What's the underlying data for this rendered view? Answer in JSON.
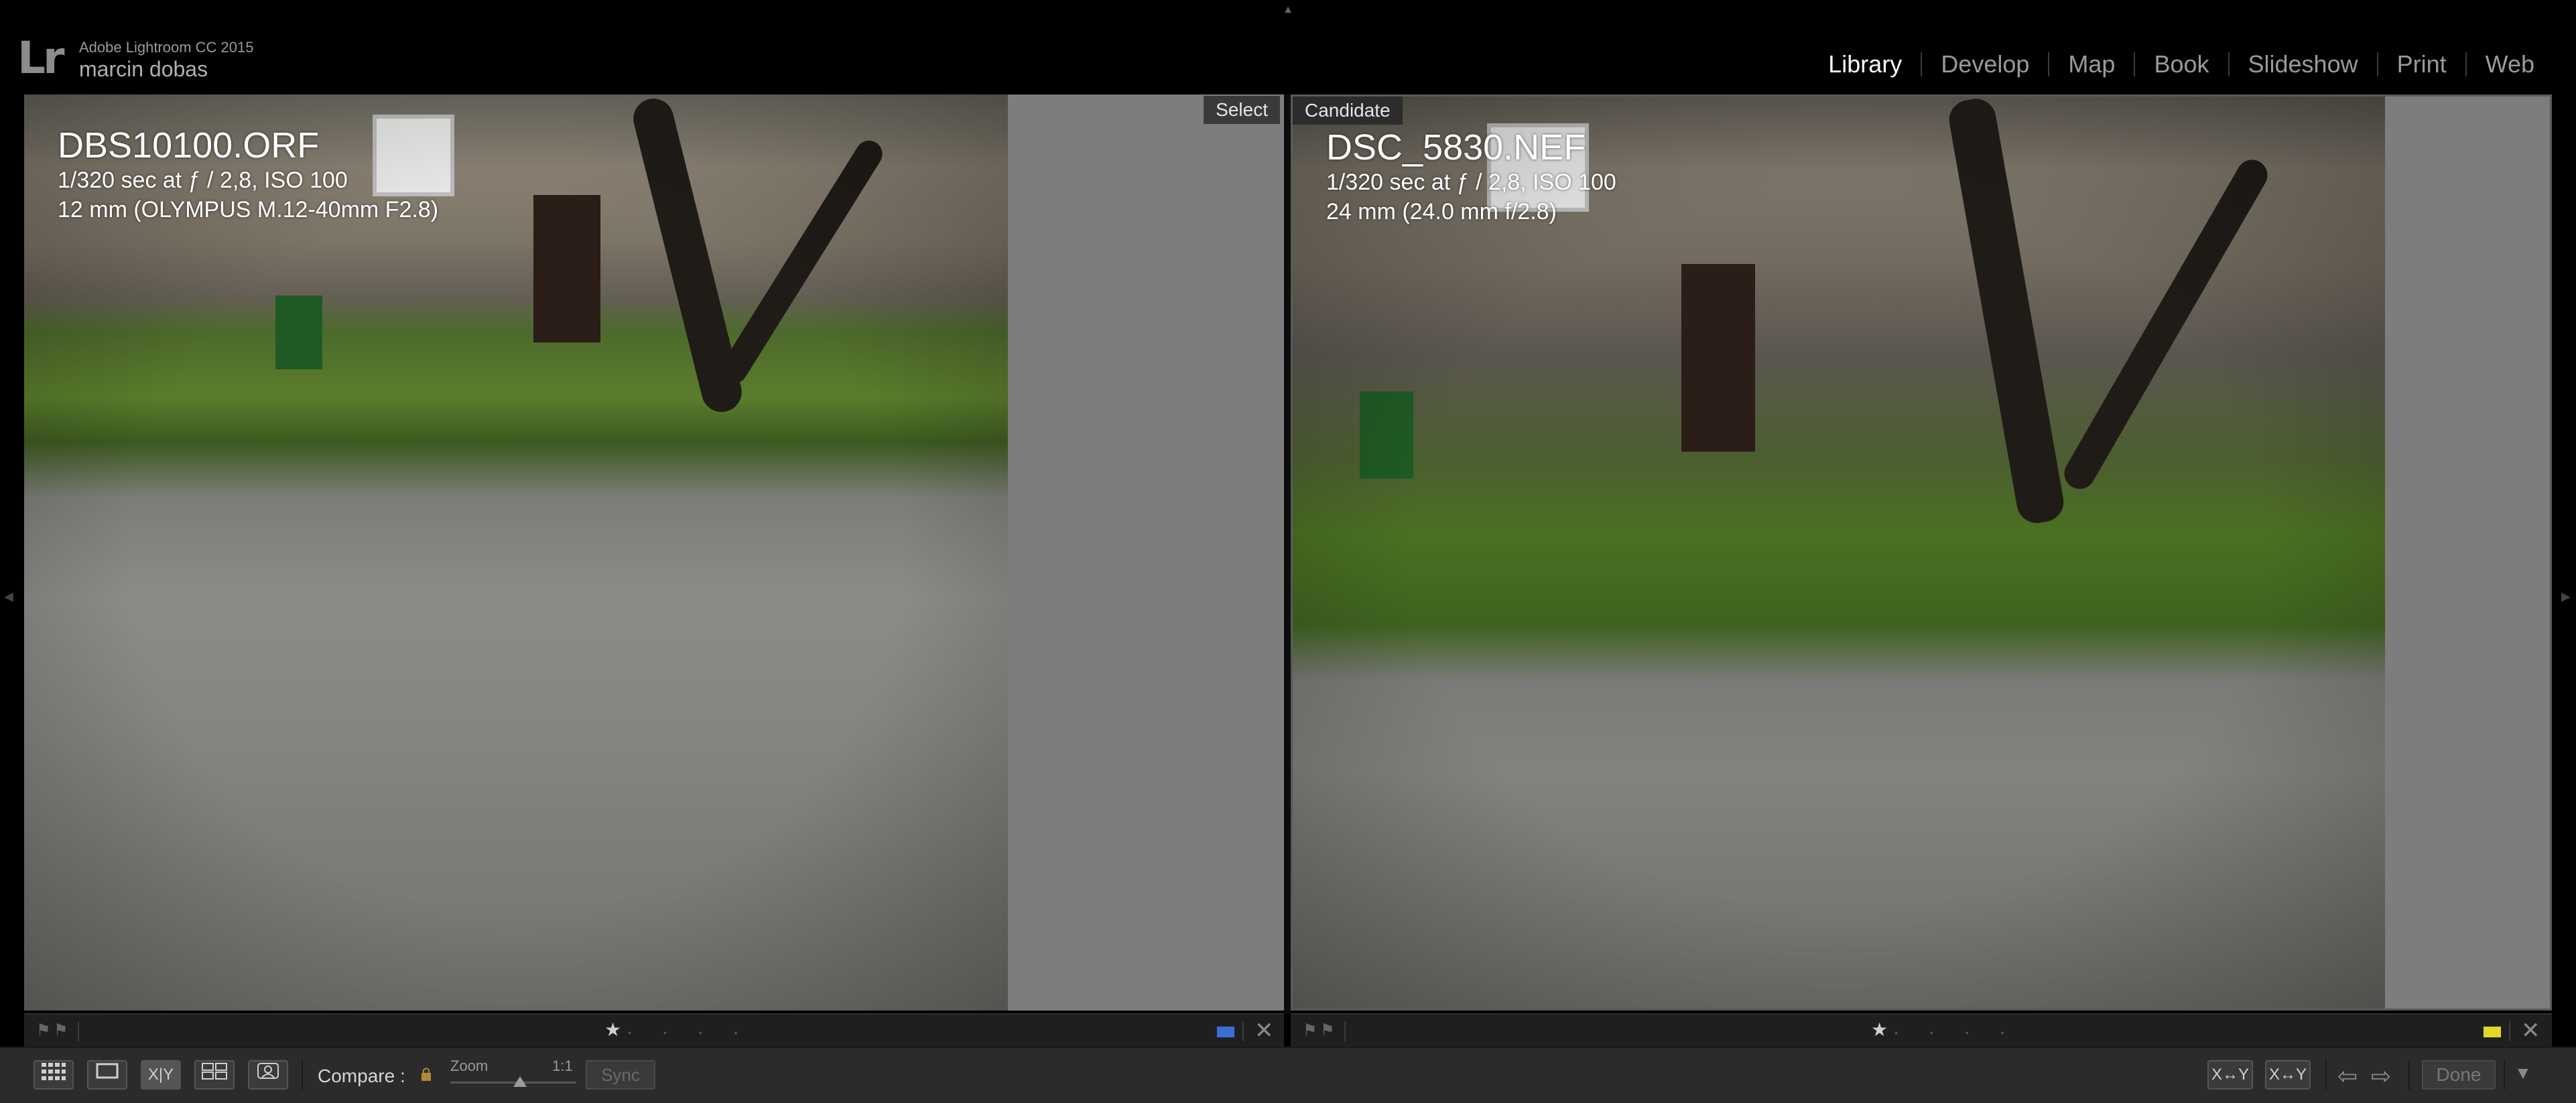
{
  "identity": {
    "logo": "Lr",
    "app_name": "Adobe Lightroom CC 2015",
    "user_name": "marcin dobas"
  },
  "modules": [
    {
      "label": "Library",
      "active": true
    },
    {
      "label": "Develop",
      "active": false
    },
    {
      "label": "Map",
      "active": false
    },
    {
      "label": "Book",
      "active": false
    },
    {
      "label": "Slideshow",
      "active": false
    },
    {
      "label": "Print",
      "active": false
    },
    {
      "label": "Web",
      "active": false
    }
  ],
  "select_pane": {
    "tag": "Select",
    "filename": "DBS10100.ORF",
    "exposure": "1/320 sec at ƒ / 2,8, ISO 100",
    "lens": "12 mm (OLYMPUS M.12-40mm F2.8)",
    "rating": 1,
    "color_label": "#3a6fd8"
  },
  "candidate_pane": {
    "tag": "Candidate",
    "filename": "DSC_5830.NEF",
    "exposure": "1/320 sec at ƒ / 2,8, ISO 100",
    "lens": "24 mm (24.0 mm f/2.8)",
    "rating": 1,
    "color_label": "#e0d92a"
  },
  "toolbar": {
    "compare_label": "Compare :",
    "zoom_label": "Zoom",
    "zoom_value": "1:1",
    "sync_label": "Sync",
    "swap_label": "X|Y",
    "done_label": "Done"
  },
  "icons": {
    "grid_view": "grid-icon",
    "loupe_view": "loupe-icon",
    "compare_view": "compare-icon",
    "survey_view": "survey-icon",
    "people_view": "people-icon",
    "lock": "lock-icon",
    "prev": "arrow-left-icon",
    "next": "arrow-right-icon",
    "close": "close-icon",
    "flag": "flag-icon",
    "star": "star-icon"
  },
  "glyphs": {
    "top_handle": "▲",
    "side_left": "◀",
    "side_right": "▶",
    "flag": "⚑",
    "star": "★",
    "dots": "• • • •",
    "close": "✕",
    "lock": "🔒",
    "swap_xy": "X↔Y",
    "arrow_left": "⇦",
    "arrow_right": "⇨",
    "chevron_down": "▼"
  }
}
